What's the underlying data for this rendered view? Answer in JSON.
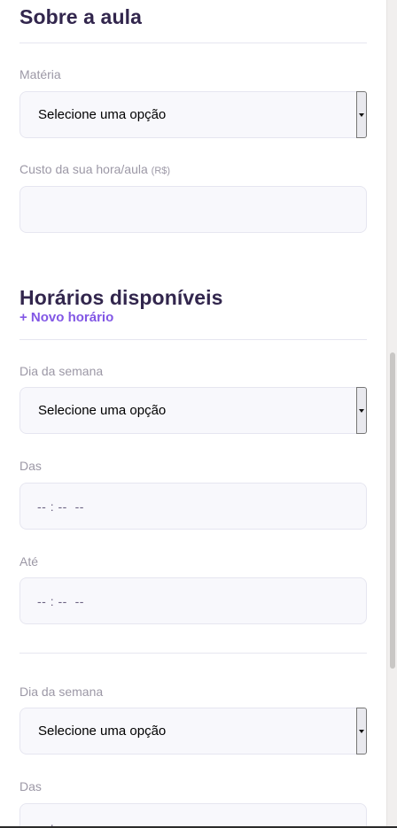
{
  "about": {
    "title": "Sobre a aula",
    "subject_label": "Matéria",
    "subject_value": "Selecione uma opção",
    "cost_label": "Custo da sua hora/aula",
    "cost_hint": "(R$)",
    "cost_value": ""
  },
  "schedule": {
    "title": "Horários disponíveis",
    "add_label": "+ Novo horário",
    "items": [
      {
        "weekday_label": "Dia da semana",
        "weekday_value": "Selecione uma opção",
        "from_label": "Das",
        "from_value": "-- : --  --",
        "to_label": "Até",
        "to_value": "-- : --  --"
      },
      {
        "weekday_label": "Dia da semana",
        "weekday_value": "Selecione uma opção",
        "from_label": "Das",
        "from_value": "-- : --  --"
      }
    ]
  }
}
